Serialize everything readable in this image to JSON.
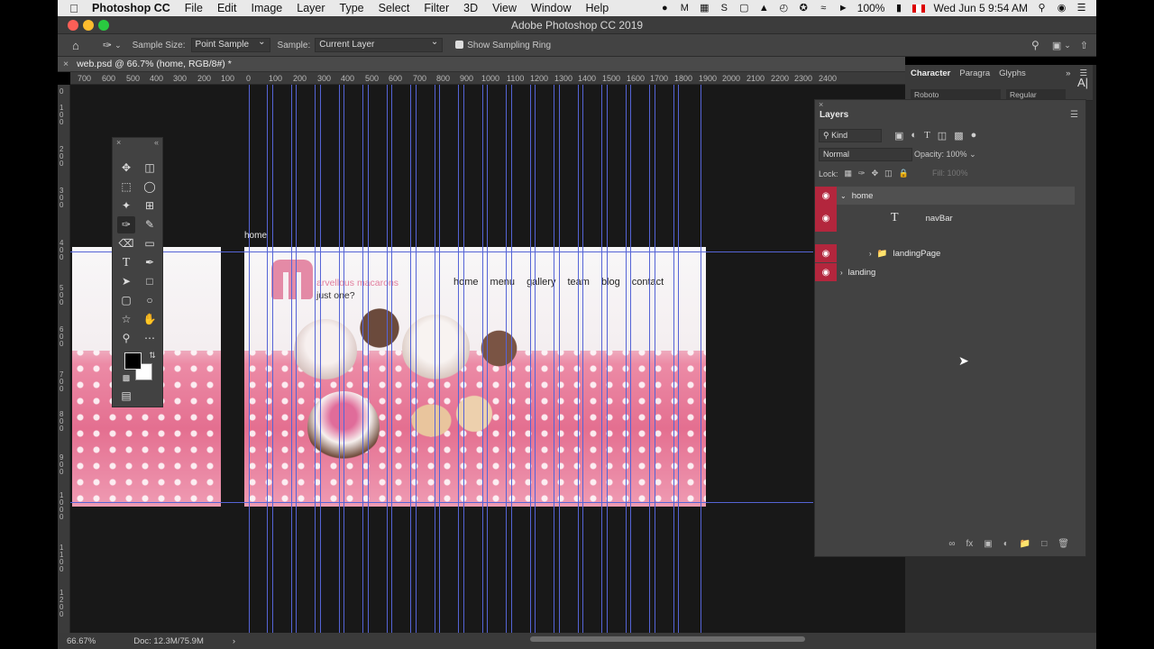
{
  "menubar": {
    "app_name": "Photoshop CC",
    "items": [
      "File",
      "Edit",
      "Image",
      "Layer",
      "Type",
      "Select",
      "Filter",
      "3D",
      "View",
      "Window",
      "Help"
    ],
    "battery": "100%",
    "datetime": "Wed Jun 5  9:54 AM"
  },
  "window": {
    "title": "Adobe Photoshop CC 2019"
  },
  "options": {
    "sample_size_label": "Sample Size:",
    "sample_size_value": "Point Sample",
    "sample_label": "Sample:",
    "sample_value": "Current Layer",
    "ring_label": "Show Sampling Ring"
  },
  "document": {
    "tab_title": "web.psd @ 66.7% (home, RGB/8#) *"
  },
  "ruler": {
    "h_labels": [
      "700",
      "600",
      "500",
      "400",
      "300",
      "200",
      "100",
      "0",
      "100",
      "200",
      "300",
      "400",
      "500",
      "600",
      "700",
      "800",
      "900",
      "1000",
      "1100",
      "1200",
      "1300",
      "1400",
      "1500",
      "1600",
      "1700",
      "1800",
      "1900",
      "2000",
      "2100",
      "2200",
      "2300",
      "2400"
    ],
    "v_labels": [
      "0",
      "100",
      "200",
      "300",
      "400",
      "500",
      "600",
      "700",
      "800",
      "900",
      "1000",
      "1100",
      "1200"
    ]
  },
  "artboard": {
    "label": "home",
    "logo_text": "arvellous macarons",
    "logo_sub": "just one?",
    "nav": [
      "home",
      "menu",
      "gallery",
      "team",
      "blog",
      "contact"
    ]
  },
  "character": {
    "tabs": [
      "Character",
      "Paragra",
      "Glyphs"
    ],
    "font": "Roboto",
    "style": "Regular"
  },
  "layers": {
    "title": "Layers",
    "kind": "Kind",
    "blend": "Normal",
    "opacity_label": "Opacity:",
    "opacity_value": "100%",
    "lock_label": "Lock:",
    "fill_label": "Fill:",
    "fill_value": "100%",
    "rows": [
      {
        "name": "home"
      },
      {
        "name": "navBar"
      },
      {
        "name": "landingPage"
      },
      {
        "name": "landing"
      }
    ]
  },
  "status": {
    "zoom": "66.67%",
    "doc": "Doc: 12.3M/75.9M"
  },
  "colors": {
    "guide": "#5564d6",
    "eye_bg": "#b3263d",
    "accent_pink": "#e27f9e"
  }
}
